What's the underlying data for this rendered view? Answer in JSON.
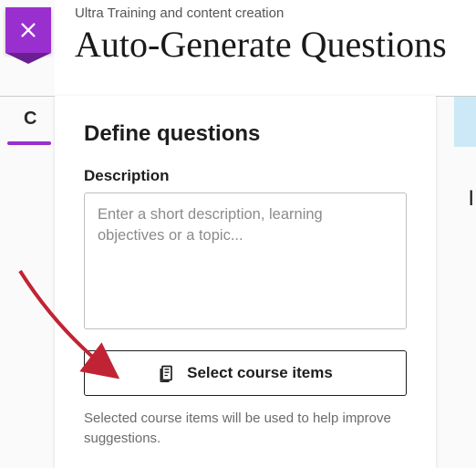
{
  "colors": {
    "accent": "#9a2fcf",
    "annotation": "#c02434"
  },
  "background": {
    "tab_letter": "C",
    "right_letter": "I"
  },
  "header": {
    "breadcrumb": "Ultra Training and content creation",
    "title": "Auto-Generate Questions"
  },
  "panel": {
    "section_heading": "Define questions",
    "description_label": "Description",
    "description_placeholder": "Enter a short description, learning objectives or a topic...",
    "description_value": "",
    "select_button_label": "Select course items",
    "hint": "Selected course items will be used to help improve suggestions."
  }
}
